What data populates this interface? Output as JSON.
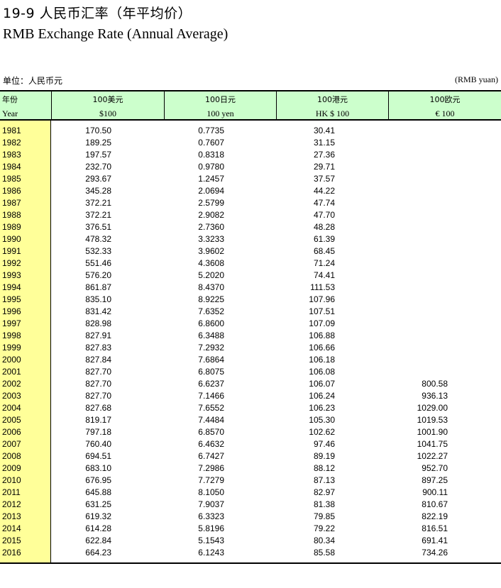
{
  "title": {
    "cn": "19-9 人民币汇率（年平均价）",
    "en": "RMB Exchange Rate (Annual Average)"
  },
  "unit": {
    "cn": "单位：人民币元",
    "en": "(RMB yuan)"
  },
  "header": {
    "year": {
      "cn": "年份",
      "en": "Year"
    },
    "usd": {
      "cn": "100美元",
      "en": "$100"
    },
    "jpy": {
      "cn": "100日元",
      "en": "100 yen"
    },
    "hkd": {
      "cn": "100港元",
      "en": "HK $ 100"
    },
    "eur": {
      "cn": "100欧元",
      "en": "€ 100"
    }
  },
  "rows": [
    {
      "year": "1981",
      "usd": "170.50",
      "jpy": "0.7735",
      "hkd": "30.41",
      "eur": ""
    },
    {
      "year": "1982",
      "usd": "189.25",
      "jpy": "0.7607",
      "hkd": "31.15",
      "eur": ""
    },
    {
      "year": "1983",
      "usd": "197.57",
      "jpy": "0.8318",
      "hkd": "27.36",
      "eur": ""
    },
    {
      "year": "1984",
      "usd": "232.70",
      "jpy": "0.9780",
      "hkd": "29.71",
      "eur": ""
    },
    {
      "year": "1985",
      "usd": "293.67",
      "jpy": "1.2457",
      "hkd": "37.57",
      "eur": ""
    },
    {
      "year": "1986",
      "usd": "345.28",
      "jpy": "2.0694",
      "hkd": "44.22",
      "eur": ""
    },
    {
      "year": "1987",
      "usd": "372.21",
      "jpy": "2.5799",
      "hkd": "47.74",
      "eur": ""
    },
    {
      "year": "1988",
      "usd": "372.21",
      "jpy": "2.9082",
      "hkd": "47.70",
      "eur": ""
    },
    {
      "year": "1989",
      "usd": "376.51",
      "jpy": "2.7360",
      "hkd": "48.28",
      "eur": ""
    },
    {
      "year": "1990",
      "usd": "478.32",
      "jpy": "3.3233",
      "hkd": "61.39",
      "eur": ""
    },
    {
      "year": "1991",
      "usd": "532.33",
      "jpy": "3.9602",
      "hkd": "68.45",
      "eur": ""
    },
    {
      "year": "1992",
      "usd": "551.46",
      "jpy": "4.3608",
      "hkd": "71.24",
      "eur": ""
    },
    {
      "year": "1993",
      "usd": "576.20",
      "jpy": "5.2020",
      "hkd": "74.41",
      "eur": ""
    },
    {
      "year": "1994",
      "usd": "861.87",
      "jpy": "8.4370",
      "hkd": "111.53",
      "eur": ""
    },
    {
      "year": "1995",
      "usd": "835.10",
      "jpy": "8.9225",
      "hkd": "107.96",
      "eur": ""
    },
    {
      "year": "1996",
      "usd": "831.42",
      "jpy": "7.6352",
      "hkd": "107.51",
      "eur": ""
    },
    {
      "year": "1997",
      "usd": "828.98",
      "jpy": "6.8600",
      "hkd": "107.09",
      "eur": ""
    },
    {
      "year": "1998",
      "usd": "827.91",
      "jpy": "6.3488",
      "hkd": "106.88",
      "eur": ""
    },
    {
      "year": "1999",
      "usd": "827.83",
      "jpy": "7.2932",
      "hkd": "106.66",
      "eur": ""
    },
    {
      "year": "2000",
      "usd": "827.84",
      "jpy": "7.6864",
      "hkd": "106.18",
      "eur": ""
    },
    {
      "year": "2001",
      "usd": "827.70",
      "jpy": "6.8075",
      "hkd": "106.08",
      "eur": ""
    },
    {
      "year": "2002",
      "usd": "827.70",
      "jpy": "6.6237",
      "hkd": "106.07",
      "eur": "800.58"
    },
    {
      "year": "2003",
      "usd": "827.70",
      "jpy": "7.1466",
      "hkd": "106.24",
      "eur": "936.13"
    },
    {
      "year": "2004",
      "usd": "827.68",
      "jpy": "7.6552",
      "hkd": "106.23",
      "eur": "1029.00"
    },
    {
      "year": "2005",
      "usd": "819.17",
      "jpy": "7.4484",
      "hkd": "105.30",
      "eur": "1019.53"
    },
    {
      "year": "2006",
      "usd": "797.18",
      "jpy": "6.8570",
      "hkd": "102.62",
      "eur": "1001.90"
    },
    {
      "year": "2007",
      "usd": "760.40",
      "jpy": "6.4632",
      "hkd": "97.46",
      "eur": "1041.75"
    },
    {
      "year": "2008",
      "usd": "694.51",
      "jpy": "6.7427",
      "hkd": "89.19",
      "eur": "1022.27"
    },
    {
      "year": "2009",
      "usd": "683.10",
      "jpy": "7.2986",
      "hkd": "88.12",
      "eur": "952.70"
    },
    {
      "year": "2010",
      "usd": "676.95",
      "jpy": "7.7279",
      "hkd": "87.13",
      "eur": "897.25"
    },
    {
      "year": "2011",
      "usd": "645.88",
      "jpy": "8.1050",
      "hkd": "82.97",
      "eur": "900.11"
    },
    {
      "year": "2012",
      "usd": "631.25",
      "jpy": "7.9037",
      "hkd": "81.38",
      "eur": "810.67"
    },
    {
      "year": "2013",
      "usd": "619.32",
      "jpy": "6.3323",
      "hkd": "79.85",
      "eur": "822.19"
    },
    {
      "year": "2014",
      "usd": "614.28",
      "jpy": "5.8196",
      "hkd": "79.22",
      "eur": "816.51"
    },
    {
      "year": "2015",
      "usd": "622.84",
      "jpy": "5.1543",
      "hkd": "80.34",
      "eur": "691.41"
    },
    {
      "year": "2016",
      "usd": "664.23",
      "jpy": "6.1243",
      "hkd": "85.58",
      "eur": "734.26"
    }
  ]
}
